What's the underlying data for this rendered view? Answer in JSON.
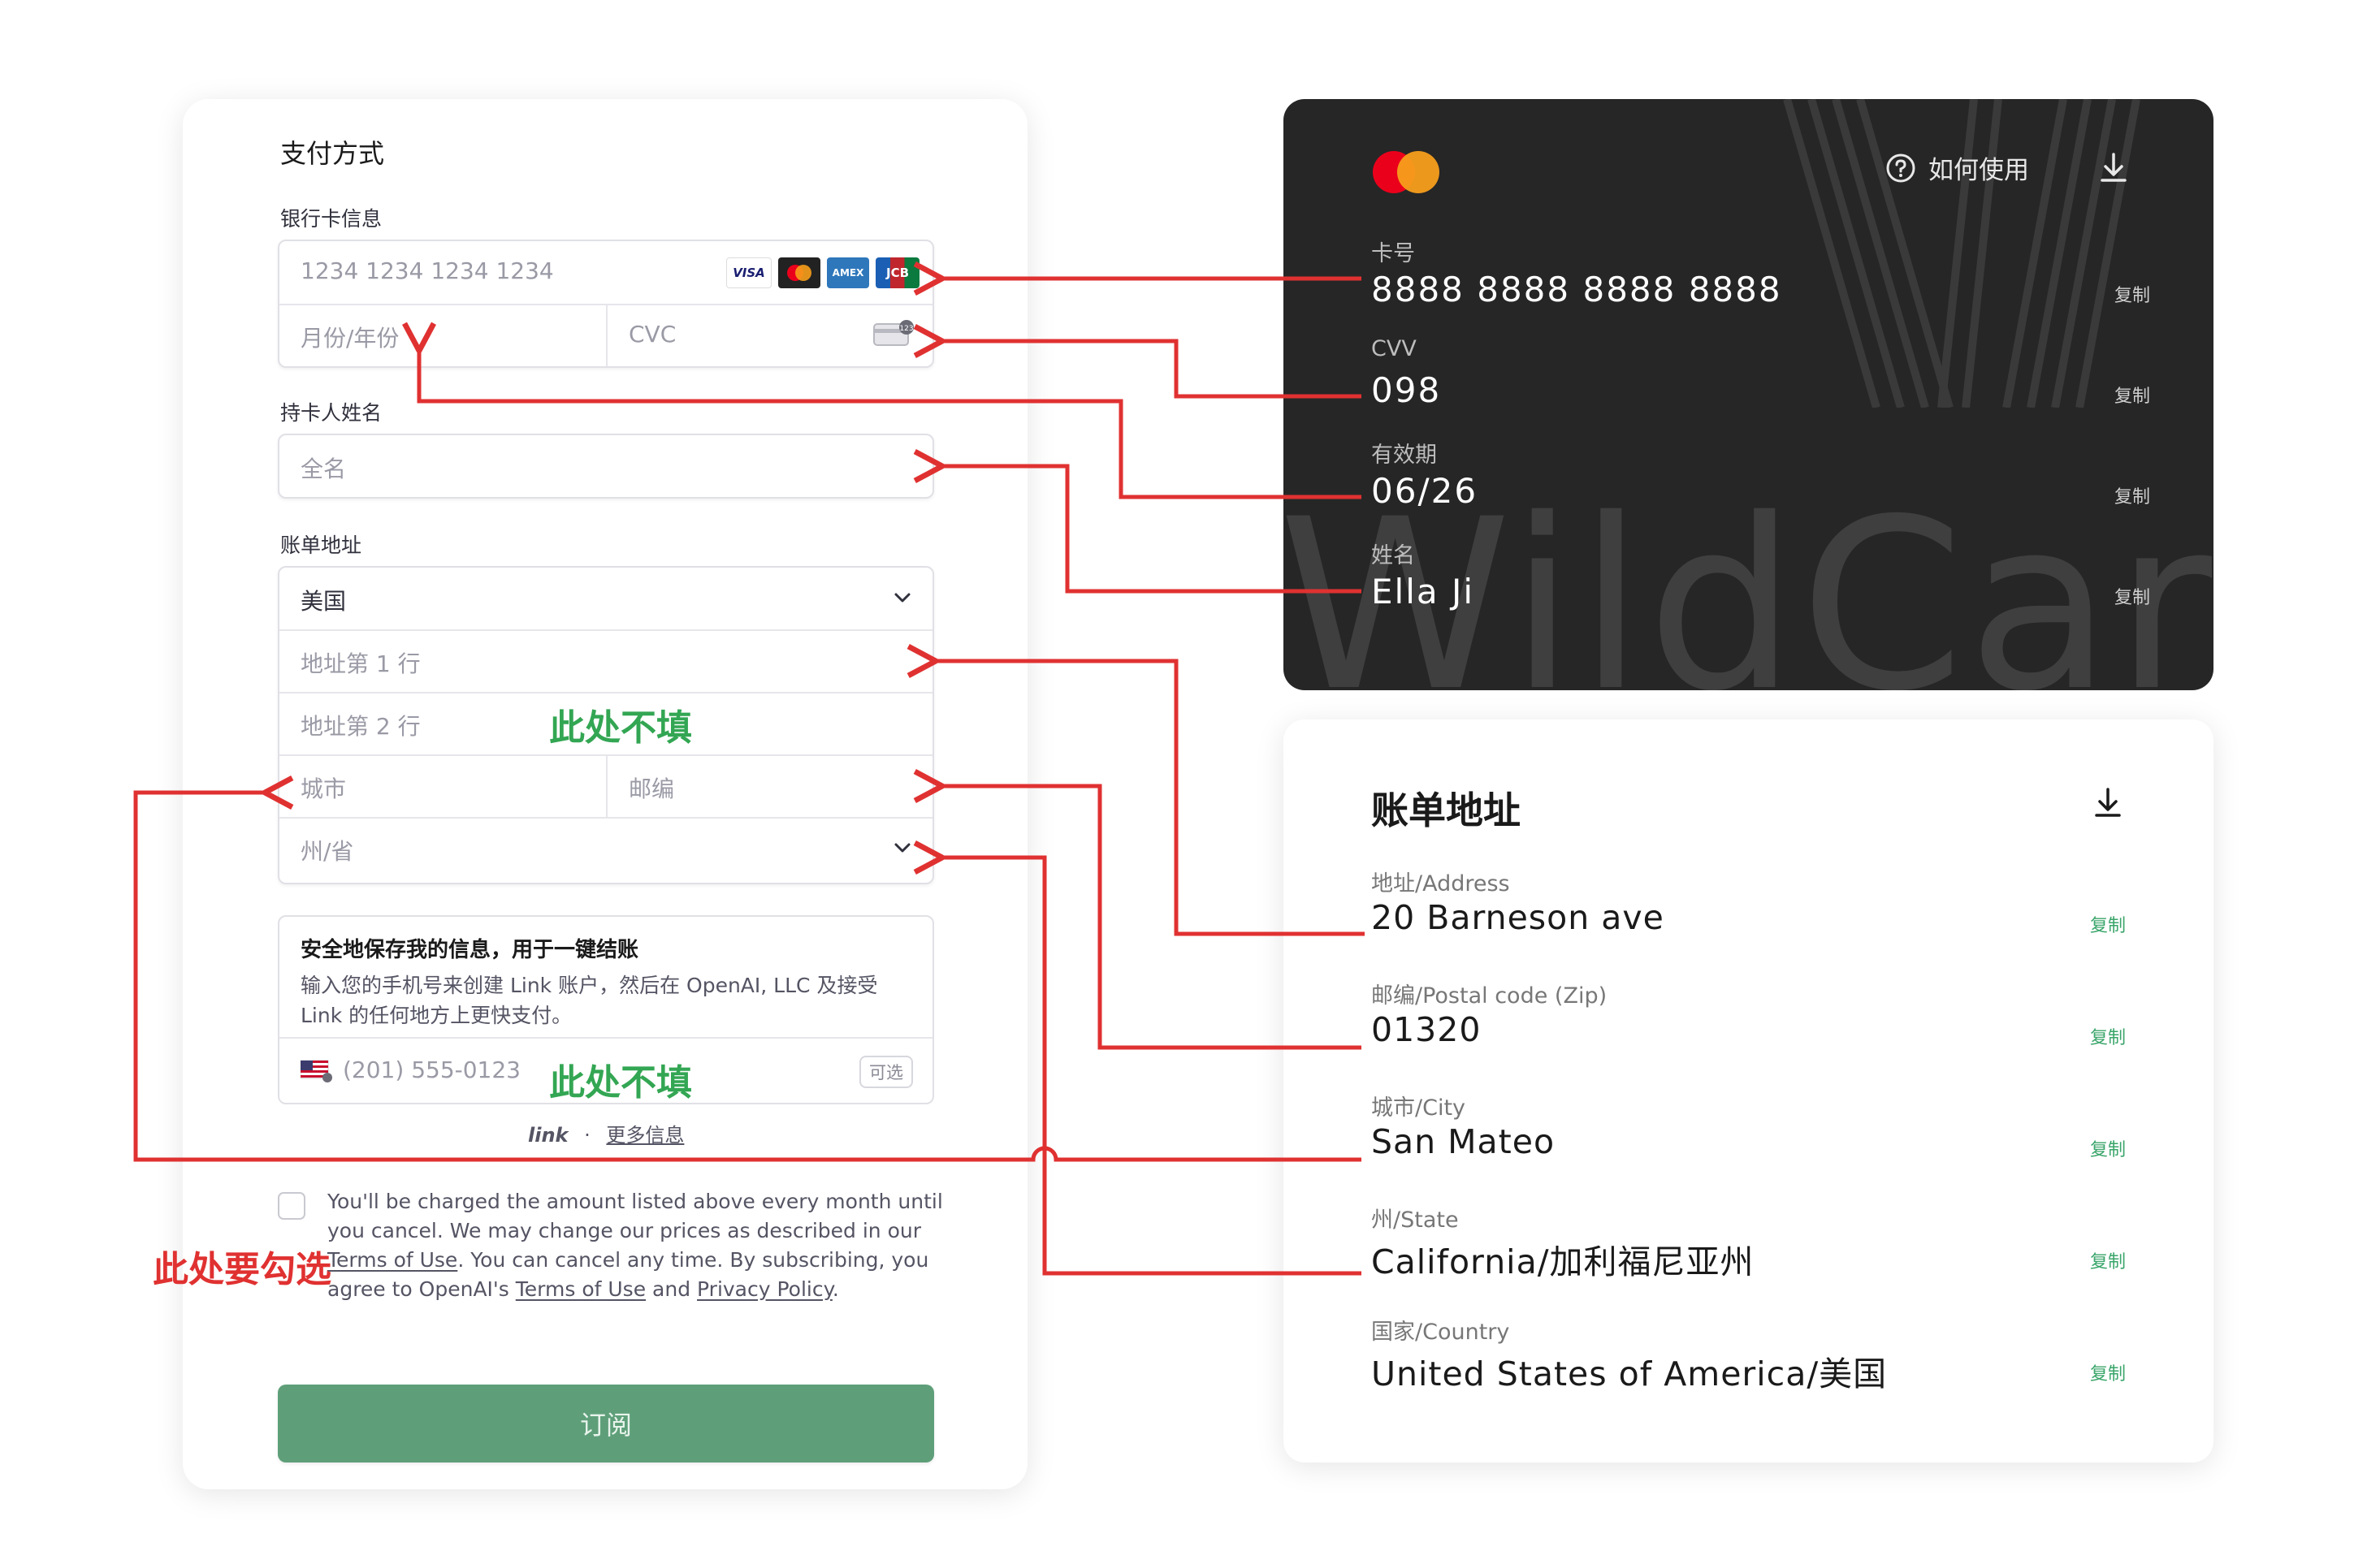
{
  "form": {
    "title": "支付方式",
    "card_info_label": "银行卡信息",
    "card_number_placeholder": "1234 1234 1234 1234",
    "card_brands": [
      {
        "name": "VISA",
        "color": "#ffffff",
        "text_color": "#1a1f71"
      },
      {
        "name": "MC",
        "color": "#222222",
        "text_color": "#ffffff"
      },
      {
        "name": "AMEX",
        "color": "#2e77bb",
        "text_color": "#ffffff"
      },
      {
        "name": "JCB",
        "color": "#0b7a3e",
        "text_color": "#ffffff"
      }
    ],
    "expiry_placeholder": "月份/年份",
    "cvc_placeholder": "CVC",
    "cardholder_label": "持卡人姓名",
    "fullname_placeholder": "全名",
    "billing_label": "账单地址",
    "country_value": "美国",
    "address1_placeholder": "地址第 1 行",
    "address2_placeholder": "地址第 2 行",
    "city_placeholder": "城市",
    "zip_placeholder": "邮编",
    "state_placeholder": "州/省",
    "link_title": "安全地保存我的信息，用于一键结账",
    "link_desc": "输入您的手机号来创建 Link 账户，然后在 OpenAI, LLC 及接受 Link 的任何地方上更快支付。",
    "phone_placeholder": "(201) 555-0123",
    "optional_badge": "可选",
    "link_logo": "link",
    "more_info": "更多信息",
    "terms_part1": "You'll be charged the amount listed above every month until you cancel. We may change our prices as described in our ",
    "terms_link1": "Terms of Use",
    "terms_part2": ". You can cancel any time. By subscribing, you agree to OpenAI's ",
    "terms_link2": "Terms of Use",
    "terms_part3": " and ",
    "terms_link3": "Privacy Policy",
    "terms_part4": ".",
    "subscribe_label": "订阅"
  },
  "card": {
    "help_label": "如何使用",
    "number_label": "卡号",
    "number_value": "8888 8888 8888 8888",
    "cvv_label": "CVV",
    "cvv_value": "098",
    "expiry_label": "有效期",
    "expiry_value": "06/26",
    "name_label": "姓名",
    "name_value": "Ella Ji",
    "copy_label": "复制",
    "watermark": "WildCard",
    "logo_colors": [
      "#eb001b",
      "#f79e1b"
    ]
  },
  "billing": {
    "title": "账单地址",
    "address_label": "地址/Address",
    "address_value": "20 Barneson ave",
    "zip_label": "邮编/Postal code (Zip)",
    "zip_value": "01320",
    "city_label": "城市/City",
    "city_value": "San Mateo",
    "state_label": "州/State",
    "state_value": "California/加利福尼亚州",
    "country_label": "国家/Country",
    "country_value": "United States of America/美国",
    "copy_label": "复制"
  },
  "annotations": {
    "skip_address2": "此处不填",
    "skip_phone": "此处不填",
    "must_check": "此处要勾选",
    "arrow_color": "#e03131",
    "note_color": "#33a653"
  }
}
